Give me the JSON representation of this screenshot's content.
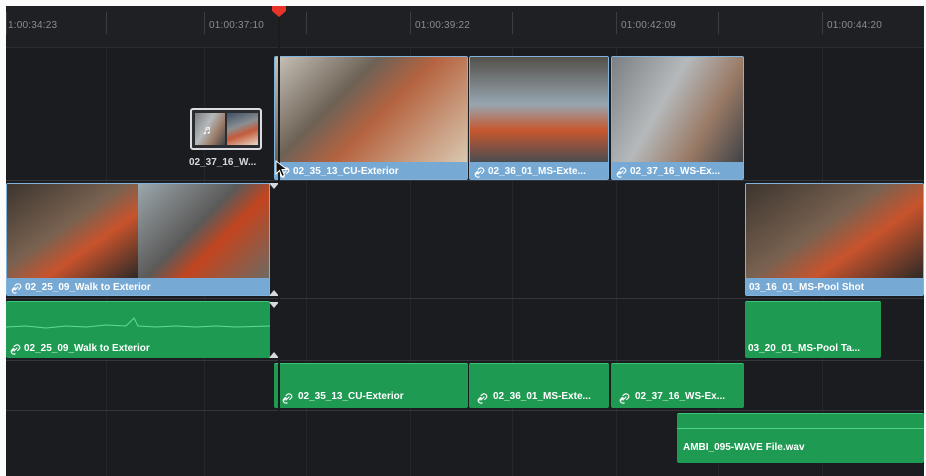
{
  "ruler": {
    "timecodes": [
      "1:00:34:23",
      "01:00:37:10",
      "01:00:39:22",
      "01:00:42:09",
      "01:00:44:20"
    ]
  },
  "video_track_2": {
    "small_clip_label": "02_37_16_W...",
    "clips": [
      {
        "label": "02_35_13_CU-Exterior"
      },
      {
        "label": "02_36_01_MS-Exte..."
      },
      {
        "label": "02_37_16_WS-Ex..."
      }
    ]
  },
  "video_track_1": {
    "clips": [
      {
        "label": "02_25_09_Walk to Exterior"
      },
      {
        "label": "03_16_01_MS-Pool Shot"
      }
    ]
  },
  "audio_track_1": {
    "clips": [
      {
        "label": "02_25_09_Walk to Exterior"
      },
      {
        "label": "03_20_01_MS-Pool Ta..."
      }
    ]
  },
  "audio_track_2": {
    "clips": [
      {
        "label": "02_35_13_CU-Exterior"
      },
      {
        "label": "02_36_01_MS-Exte..."
      },
      {
        "label": "02_37_16_WS-Ex..."
      }
    ]
  },
  "audio_track_3": {
    "clips": [
      {
        "label": "AMBI_095-WAVE File.wav"
      }
    ]
  },
  "colors": {
    "video_clip_bar": "#76a9d4",
    "video_clip_border": "#7fb3de",
    "audio_clip": "#1f9a52",
    "playhead": "#e8332a",
    "background": "#1b1c1f"
  },
  "icons": [
    "link-icon",
    "audio-note-icon",
    "playhead-marker-icon",
    "mouse-cursor-icon",
    "trim-marker-icon"
  ]
}
